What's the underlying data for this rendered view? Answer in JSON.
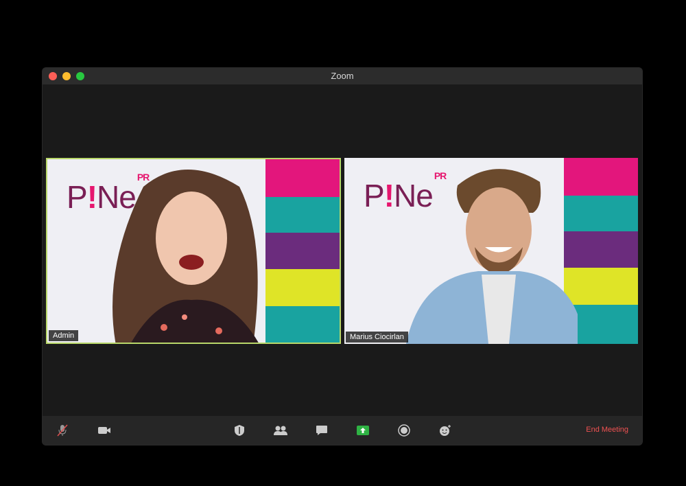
{
  "window": {
    "title": "Zoom"
  },
  "tiles": {
    "left": {
      "name": "Admin",
      "logo_text": "P!Ne",
      "logo_sup": "PR"
    },
    "right": {
      "name": "Marius Ciocirlan",
      "logo_text": "P!Ne",
      "logo_sup": "PR"
    }
  },
  "toolbar": {
    "icons": [
      "mute-icon",
      "video-icon",
      "security-icon",
      "participants-icon",
      "chat-icon",
      "share-screen-icon",
      "record-icon",
      "reactions-icon"
    ],
    "end_meeting": "End Meeting"
  },
  "colors": {
    "active_speaker_border": "#b9d86a",
    "share_green": "#2fb344",
    "end_meeting": "#f05252"
  }
}
